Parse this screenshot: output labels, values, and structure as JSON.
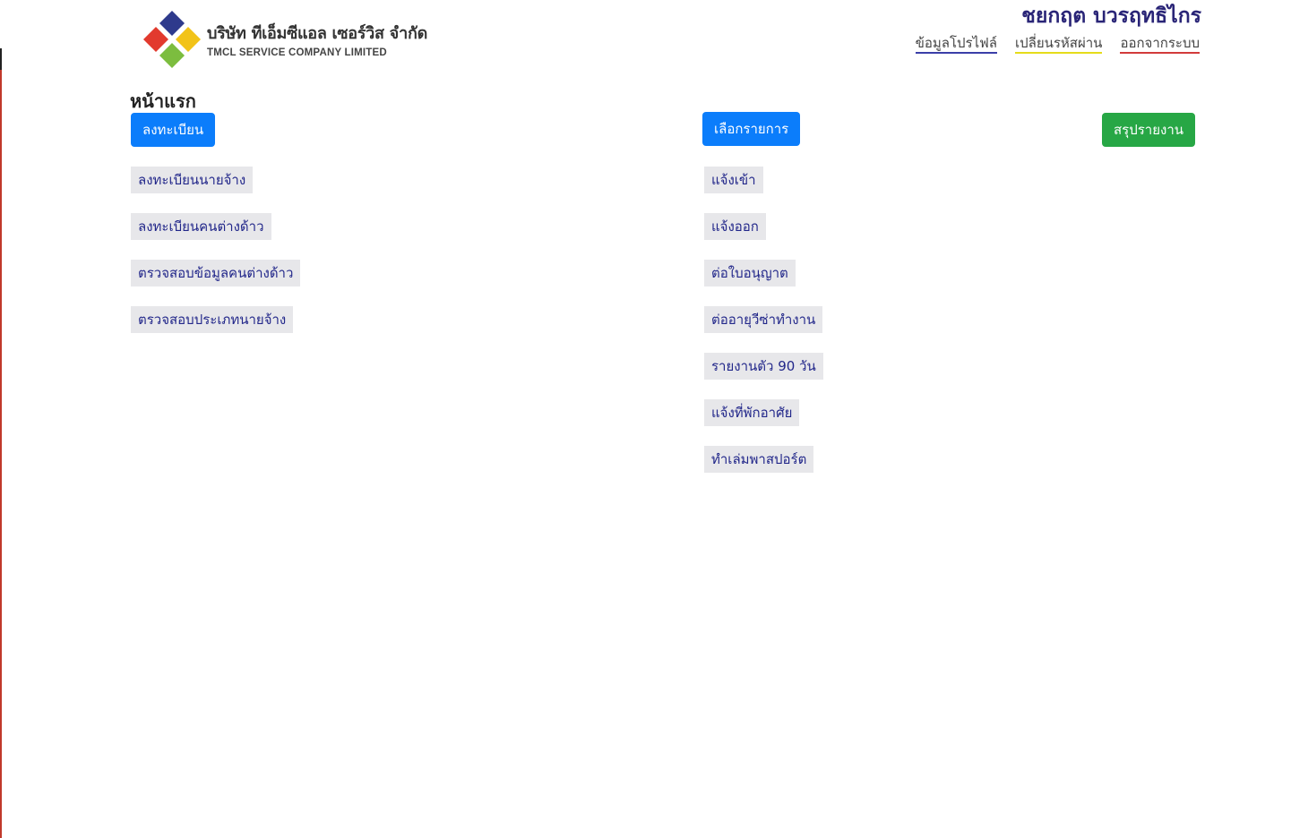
{
  "company": {
    "name_th": "บริษัท ทีเอ็มซีแอล เซอร์วิส จำกัด",
    "name_en": "TMCL SERVICE COMPANY LIMITED"
  },
  "user": {
    "name": "ชยกฤต บวรฤทธิไกร"
  },
  "top_links": {
    "profile": "ข้อมูลโปรไฟล์",
    "change_password": "เปลี่ยนรหัสผ่าน",
    "logout": "ออกจากระบบ"
  },
  "page_title": "หน้าแรก",
  "buttons": {
    "register": "ลงทะเบียน",
    "select_item": "เลือกรายการ",
    "summary_report": "สรุปรายงาน"
  },
  "register_menu": [
    "ลงทะเบียนนายจ้าง",
    "ลงทะเบียนคนต่างด้าว",
    "ตรวจสอบข้อมูลคนต่างด้าว",
    "ตรวจสอบประเภทนายจ้าง"
  ],
  "select_menu": [
    "แจ้งเข้า",
    "แจ้งออก",
    "ต่อใบอนุญาต",
    "ต่ออายุวีซ่าทำงาน",
    "รายงานตัว 90 วัน",
    "แจ้งที่พักอาศัย",
    "ทำเล่มพาสปอร์ต"
  ],
  "colors": {
    "primary_button": "#0b7dfb",
    "success_button": "#27a745",
    "menu_item_bg": "#e7e7ea",
    "menu_item_text": "#22278a",
    "user_name": "#2a2577"
  }
}
